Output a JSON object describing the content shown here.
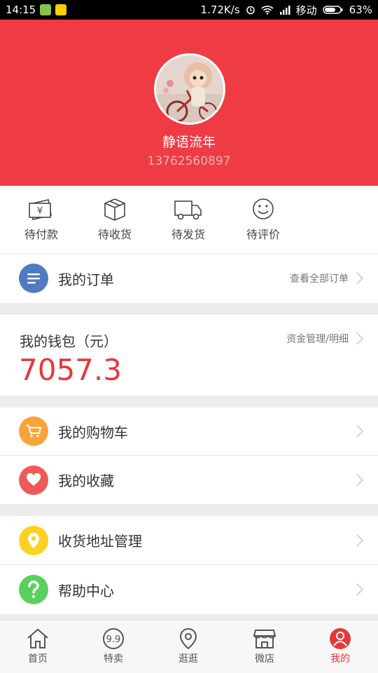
{
  "status_bar": {
    "time": "14:15",
    "speed": "1.72K/s",
    "carrier": "移动",
    "battery": "63%"
  },
  "profile": {
    "username": "静语流年",
    "phone": "13762560897"
  },
  "order_status": [
    {
      "label": "待付款",
      "icon": "wallet-yuan-icon"
    },
    {
      "label": "待收货",
      "icon": "package-box-icon"
    },
    {
      "label": "待发货",
      "icon": "truck-icon"
    },
    {
      "label": "待评价",
      "icon": "smiley-icon"
    }
  ],
  "my_orders": {
    "label": "我的订单",
    "link": "查看全部订单"
  },
  "wallet": {
    "title": "我的钱包（元）",
    "link": "资金管理/明细",
    "amount": "7057.3"
  },
  "menu": {
    "cart": "我的购物车",
    "favorites": "我的收藏",
    "address": "收货地址管理",
    "help": "帮助中心"
  },
  "tabs": [
    {
      "label": "首页",
      "icon": "home-icon",
      "active": false
    },
    {
      "label": "特卖",
      "icon": "sale-99-icon",
      "active": false
    },
    {
      "label": "逛逛",
      "icon": "location-pin-icon",
      "active": false
    },
    {
      "label": "微店",
      "icon": "shop-icon",
      "active": false
    },
    {
      "label": "我的",
      "icon": "profile-icon",
      "active": true
    }
  ],
  "colors": {
    "header_red": "#ef3b44",
    "amount_red": "#e4393c",
    "orders_icon_bg": "#4f7bc2",
    "cart_icon_bg": "#fba33a",
    "favorites_icon_bg": "#ee5a58",
    "address_icon_bg": "#fcd222",
    "help_icon_bg": "#59d05c"
  }
}
